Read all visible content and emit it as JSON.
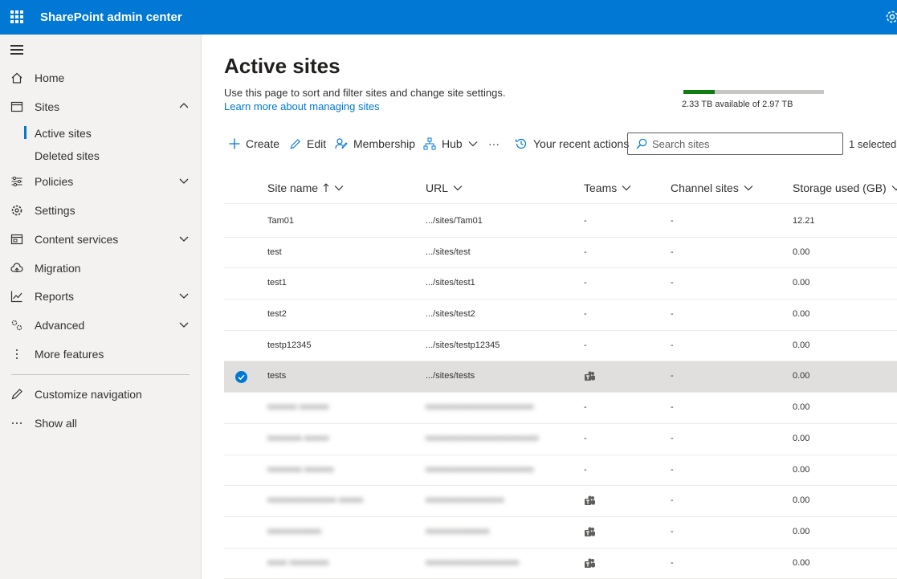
{
  "app": {
    "title": "SharePoint admin center"
  },
  "sidebar": {
    "items": [
      {
        "label": "Home",
        "icon": "home-icon"
      },
      {
        "label": "Sites",
        "icon": "sites-icon",
        "expanded": true
      },
      {
        "label": "Policies",
        "icon": "policies-icon"
      },
      {
        "label": "Settings",
        "icon": "gear-icon"
      },
      {
        "label": "Content services",
        "icon": "content-services-icon"
      },
      {
        "label": "Migration",
        "icon": "migration-icon"
      },
      {
        "label": "Reports",
        "icon": "reports-icon"
      },
      {
        "label": "Advanced",
        "icon": "advanced-icon"
      },
      {
        "label": "More features",
        "icon": "more-features-icon"
      },
      {
        "label": "Customize navigation",
        "icon": "pencil-icon"
      },
      {
        "label": "Show all",
        "icon": "ellipsis-icon"
      }
    ],
    "subitems": [
      {
        "label": "Active sites",
        "active": true
      },
      {
        "label": "Deleted sites"
      }
    ]
  },
  "page": {
    "title": "Active sites",
    "description": "Use this page to sort and filter sites and change site settings.",
    "learn_link": "Learn more about managing sites"
  },
  "storage": {
    "text": "2.33 TB available of 2.97 TB",
    "used_fraction": 0.22,
    "fill_color": "#107c10",
    "track_color": "#c8c6c4"
  },
  "toolbar": {
    "create": "Create",
    "edit": "Edit",
    "membership": "Membership",
    "hub": "Hub",
    "more": "···",
    "recent": "Your recent actions",
    "search_placeholder": "Search sites",
    "selected": "1 selected"
  },
  "table": {
    "columns": {
      "name": "Site name",
      "url": "URL",
      "teams": "Teams",
      "channel": "Channel sites",
      "storage": "Storage used (GB)"
    },
    "rows": [
      {
        "name": "Tam01",
        "url": ".../sites/Tam01",
        "teams": "-",
        "channel": "-",
        "storage": "12.21"
      },
      {
        "name": "test",
        "url": ".../sites/test",
        "teams": "-",
        "channel": "-",
        "storage": "0.00"
      },
      {
        "name": "test1",
        "url": ".../sites/test1",
        "teams": "-",
        "channel": "-",
        "storage": "0.00"
      },
      {
        "name": "test2",
        "url": ".../sites/test2",
        "teams": "-",
        "channel": "-",
        "storage": "0.00"
      },
      {
        "name": "testp12345",
        "url": ".../sites/testp12345",
        "teams": "-",
        "channel": "-",
        "storage": "0.00"
      },
      {
        "name": "tests",
        "url": ".../sites/tests",
        "teams": "teams-icon",
        "channel": "-",
        "storage": "0.00",
        "selected": true
      },
      {
        "name": "",
        "url": "",
        "teams": "-",
        "channel": "-",
        "storage": "0.00",
        "redacted": true
      },
      {
        "name": "",
        "url": "",
        "teams": "-",
        "channel": "-",
        "storage": "0.00",
        "redacted": true
      },
      {
        "name": "",
        "url": "",
        "teams": "-",
        "channel": "-",
        "storage": "0.00",
        "redacted": true
      },
      {
        "name": "",
        "url": "",
        "teams": "teams-icon",
        "channel": "-",
        "storage": "0.00",
        "redacted": true
      },
      {
        "name": "",
        "url": "",
        "teams": "teams-icon",
        "channel": "-",
        "storage": "0.00",
        "redacted": true
      },
      {
        "name": "",
        "url": "",
        "teams": "teams-icon",
        "channel": "-",
        "storage": "0.00",
        "redacted": true
      }
    ]
  },
  "colors": {
    "brand": "#0078d4",
    "sidebar_bg": "#f3f2f1",
    "selected_row": "#e1dfdd"
  }
}
